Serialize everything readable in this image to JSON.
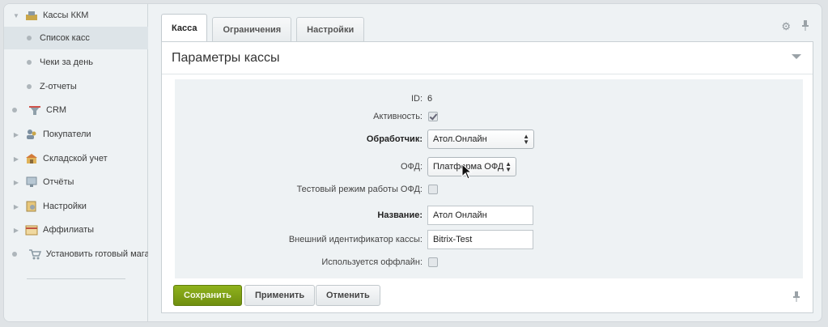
{
  "sidebar": {
    "items": [
      {
        "label": "Кассы ККМ",
        "icon": "cash-register-icon",
        "level": 0,
        "expanded": true
      },
      {
        "label": "Список касс",
        "level": 1,
        "active": true
      },
      {
        "label": "Чеки за день",
        "level": 1
      },
      {
        "label": "Z-отчеты",
        "level": 1
      },
      {
        "label": "CRM",
        "icon": "crm-filter-icon",
        "level": 0
      },
      {
        "label": "Покупатели",
        "icon": "customers-icon",
        "level": 0
      },
      {
        "label": "Складской учет",
        "icon": "warehouse-icon",
        "level": 0
      },
      {
        "label": "Отчёты",
        "icon": "reports-icon",
        "level": 0
      },
      {
        "label": "Настройки",
        "icon": "settings-icon",
        "level": 0
      },
      {
        "label": "Аффилиаты",
        "icon": "affiliates-icon",
        "level": 0
      },
      {
        "label": "Установить готовый магаз",
        "icon": "shop-cart-icon",
        "level": 0
      }
    ]
  },
  "tabs": [
    {
      "label": "Касса",
      "active": true
    },
    {
      "label": "Ограничения"
    },
    {
      "label": "Настройки"
    }
  ],
  "panel": {
    "title": "Параметры кассы"
  },
  "form": {
    "id_label": "ID:",
    "id_value": "6",
    "active_label": "Активность:",
    "active_checked": true,
    "handler_label": "Обработчик:",
    "handler_value": "Атол.Онлайн",
    "ofd_label": "ОФД:",
    "ofd_value": "Платформа ОФД",
    "test_mode_label": "Тестовый режим работы ОФД:",
    "test_mode_checked": false,
    "name_label": "Название:",
    "name_value": "Атол Онлайн",
    "external_id_label": "Внешний идентификатор кассы:",
    "external_id_value": "Bitrix-Test",
    "offline_label": "Используется оффлайн:",
    "offline_checked": false
  },
  "buttons": {
    "save": "Сохранить",
    "apply": "Применить",
    "cancel": "Отменить"
  },
  "colors": {
    "save_button": "#7da015",
    "sidebar_bg": "#eef2f4",
    "form_bg": "#eef2f4"
  }
}
